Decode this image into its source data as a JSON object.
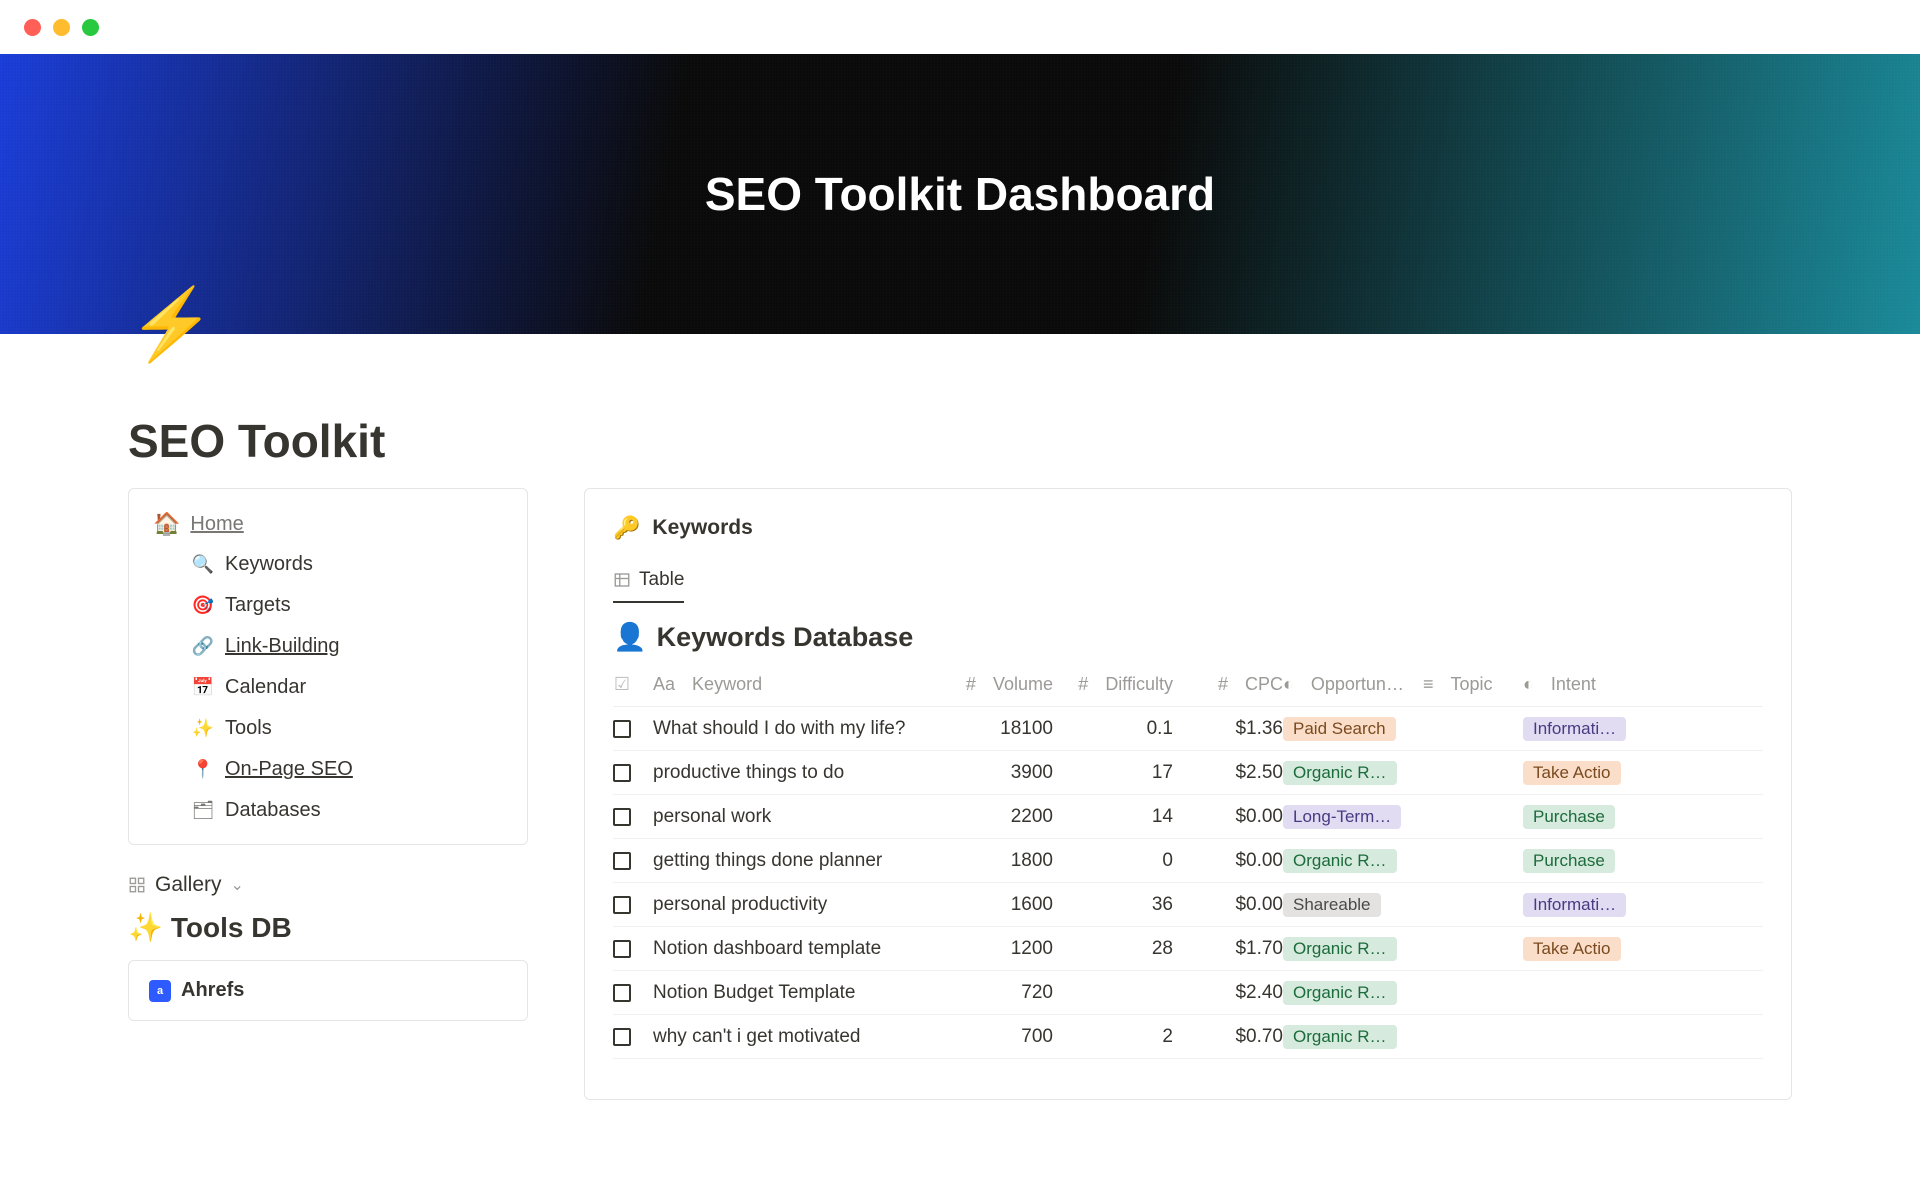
{
  "hero": {
    "title": "SEO Toolkit Dashboard"
  },
  "page": {
    "icon": "⚡",
    "title": "SEO Toolkit"
  },
  "sidebar": {
    "home_icon": "🏠",
    "home_label": "Home",
    "items": [
      {
        "icon": "🔍",
        "label": "Keywords"
      },
      {
        "icon": "🎯",
        "label": "Targets"
      },
      {
        "icon": "🔗",
        "label": "Link-Building"
      },
      {
        "icon": "📅",
        "label": "Calendar"
      },
      {
        "icon": "✨",
        "label": "Tools"
      },
      {
        "icon": "📍",
        "label": "On-Page SEO"
      },
      {
        "icon": "🗂",
        "label": "Databases"
      }
    ],
    "gallery_label": "Gallery",
    "toolsdb_title": "Tools DB",
    "tool_name": "Ahrefs"
  },
  "db": {
    "header_icon": "🔑",
    "header_title": "Keywords",
    "tab_label": "Table",
    "title": "Keywords Database",
    "columns": {
      "keyword": "Keyword",
      "volume": "Volume",
      "difficulty": "Difficulty",
      "cpc": "CPC",
      "opportunity": "Opportun…",
      "topic": "Topic",
      "intent": "Intent"
    },
    "rows": [
      {
        "keyword": "What should I do with my life?",
        "volume": "18100",
        "difficulty": "0.1",
        "cpc": "$1.36",
        "opp": "Paid Search",
        "opp_cls": "paid",
        "intent": "Informati…",
        "intent_cls": "info"
      },
      {
        "keyword": "productive things to do",
        "volume": "3900",
        "difficulty": "17",
        "cpc": "$2.50",
        "opp": "Organic R…",
        "opp_cls": "organic",
        "intent": "Take Actio",
        "intent_cls": "action"
      },
      {
        "keyword": "personal work",
        "volume": "2200",
        "difficulty": "14",
        "cpc": "$0.00",
        "opp": "Long-Term…",
        "opp_cls": "longterm",
        "intent": "Purchase",
        "intent_cls": "purchase"
      },
      {
        "keyword": "getting things done planner",
        "volume": "1800",
        "difficulty": "0",
        "cpc": "$0.00",
        "opp": "Organic R…",
        "opp_cls": "organic",
        "intent": "Purchase",
        "intent_cls": "purchase"
      },
      {
        "keyword": "personal productivity",
        "volume": "1600",
        "difficulty": "36",
        "cpc": "$0.00",
        "opp": "Shareable",
        "opp_cls": "shareable",
        "intent": "Informati…",
        "intent_cls": "info"
      },
      {
        "keyword": "Notion dashboard template",
        "volume": "1200",
        "difficulty": "28",
        "cpc": "$1.70",
        "opp": "Organic R…",
        "opp_cls": "organic",
        "intent": "Take Actio",
        "intent_cls": "action"
      },
      {
        "keyword": "Notion Budget Template",
        "volume": "720",
        "difficulty": "",
        "cpc": "$2.40",
        "opp": "Organic R…",
        "opp_cls": "organic",
        "intent": "",
        "intent_cls": ""
      },
      {
        "keyword": "why can't i get motivated",
        "volume": "700",
        "difficulty": "2",
        "cpc": "$0.70",
        "opp": "Organic R…",
        "opp_cls": "organic",
        "intent": "",
        "intent_cls": ""
      }
    ]
  }
}
